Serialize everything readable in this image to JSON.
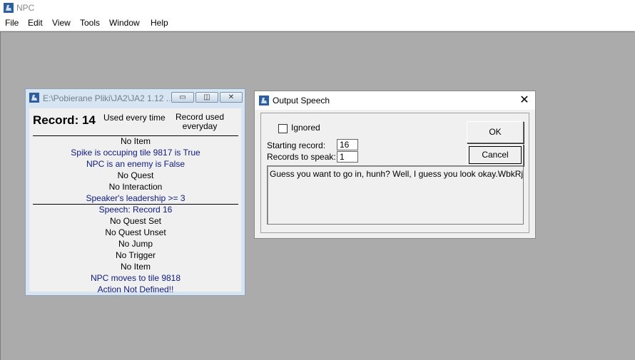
{
  "app": {
    "title": "NPC",
    "icon": "app-icon"
  },
  "menu": [
    "File",
    "Edit",
    "View",
    "Tools",
    "Window",
    "Help"
  ],
  "npc_window": {
    "title": "E:\\Pobierane Pliki\\JA2\\JA2 1.12 ...",
    "record_label": "Record: 14",
    "used_every_time": "Used every time",
    "record_used_everyday": "Record used everyday",
    "lines_top": [
      "No Item",
      "Spike is occuping tile 9817 is True",
      "NPC is an enemy is False",
      "No Quest",
      "No Interaction",
      "Speaker's leadership >= 3"
    ],
    "lines_bottom": [
      "Speech: Record 16",
      "No Quest Set",
      "No Quest Unset",
      "No Jump",
      "No Trigger",
      "No Item",
      "NPC moves to tile 9818",
      "Action Not Defined!!"
    ]
  },
  "speech_dialog": {
    "title": "Output Speech",
    "ignored_label": "Ignored",
    "ignored_checked": false,
    "starting_record_label": "Starting record:",
    "starting_record_value": "16",
    "records_to_speak_label": "Records to speak:",
    "records_to_speak_value": "1",
    "ok_label": "OK",
    "cancel_label": "Cancel",
    "speech_text": "Guess you want to go in, hunh? Well, I guess you look okay.WbkRjiFAfYEc"
  },
  "colors": {
    "desktop": "#ababab",
    "mdi_window": "#d7e4f2",
    "npc_text_blue": "#0f1a7e"
  }
}
